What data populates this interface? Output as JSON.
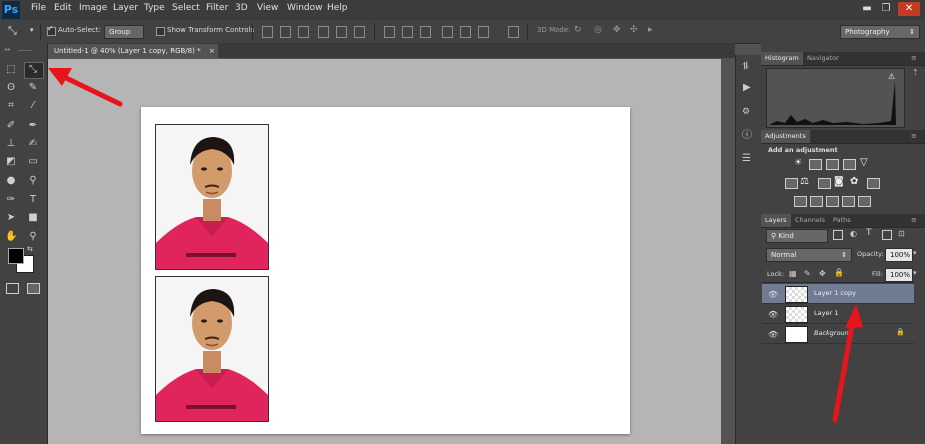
{
  "app": {
    "logo": "Ps"
  },
  "menu": [
    "File",
    "Edit",
    "Image",
    "Layer",
    "Type",
    "Select",
    "Filter",
    "3D",
    "View",
    "Window",
    "Help"
  ],
  "window_controls": {
    "minimize": "▬",
    "restore": "❐",
    "close": "✕"
  },
  "options": {
    "tool_icon": "move-tool-icon",
    "auto_select_label": "Auto-Select:",
    "auto_select_value": "Group",
    "transform_label": "Show Transform Controls",
    "mode_3d_label": "3D Mode:",
    "workspace": "Photography"
  },
  "document_tab": {
    "title": "Untitled-1 @ 40% (Layer 1 copy, RGB/8) *",
    "close": "×"
  },
  "panels": {
    "histogram_tabs": [
      "Histogram",
      "Navigator"
    ],
    "adjustments_tab": "Adjustments",
    "add_adjustment": "Add an adjustment",
    "layers_tabs": [
      "Layers",
      "Channels",
      "Paths"
    ],
    "filter_kind": "Kind",
    "blend_mode": "Normal",
    "opacity_label": "Opacity:",
    "opacity_value": "100%",
    "lock_label": "Lock:",
    "fill_label": "Fill:",
    "fill_value": "100%"
  },
  "layers": [
    {
      "name": "Layer 1 copy",
      "selected": true
    },
    {
      "name": "Layer 1",
      "selected": false
    },
    {
      "name": "Background",
      "selected": false,
      "locked": true
    }
  ],
  "colors": {
    "accent": "#e8141b",
    "selection": "#6f7c91",
    "canvas_bg": "#b5b5b5",
    "shirt": "#e0245c"
  }
}
